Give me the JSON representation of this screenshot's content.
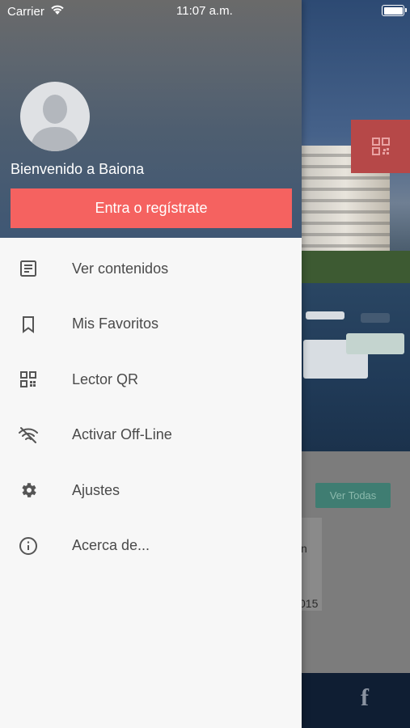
{
  "status_bar": {
    "carrier": "Carrier",
    "time": "11:07 a.m."
  },
  "drawer": {
    "welcome": "Bienvenido a Baiona",
    "login_button": "Entra o regístrate",
    "menu": [
      {
        "label": "Ver contenidos",
        "icon": "list-icon"
      },
      {
        "label": "Mis Favoritos",
        "icon": "bookmark-icon"
      },
      {
        "label": "Lector QR",
        "icon": "qr-code-icon"
      },
      {
        "label": "Activar Off-Line",
        "icon": "wifi-off-icon"
      },
      {
        "label": "Ajustes",
        "icon": "gear-icon"
      },
      {
        "label": "Acerca de...",
        "icon": "info-icon"
      }
    ]
  },
  "background": {
    "ver_todas": "Ver Todas",
    "card_text_1": "n",
    "card_text_2": "015",
    "footer_icon": "f"
  },
  "colors": {
    "accent": "#f56260",
    "fab": "#b64848",
    "ver_todas": "#3f7d72",
    "drawer_bg": "#f7f7f7",
    "menu_text": "#4a4a4a"
  }
}
